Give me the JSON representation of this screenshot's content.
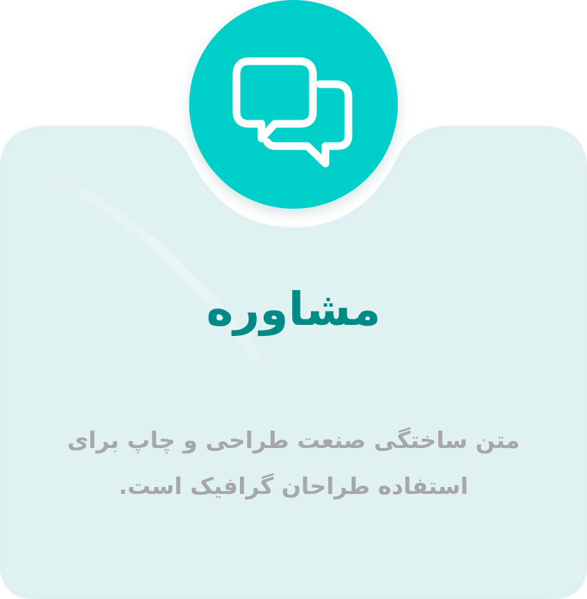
{
  "card": {
    "title": "مشاوره",
    "description": "متن ساختگی صنعت طراحی و چاپ برای استفاده طراحان گرافیک است.",
    "icon": "chat-bubbles-icon"
  },
  "colors": {
    "card_background": "#e0f1f1",
    "icon_circle": "#00cec9",
    "icon_stroke": "#ffffff",
    "title": "#008a86",
    "description": "#a7a7a7"
  }
}
